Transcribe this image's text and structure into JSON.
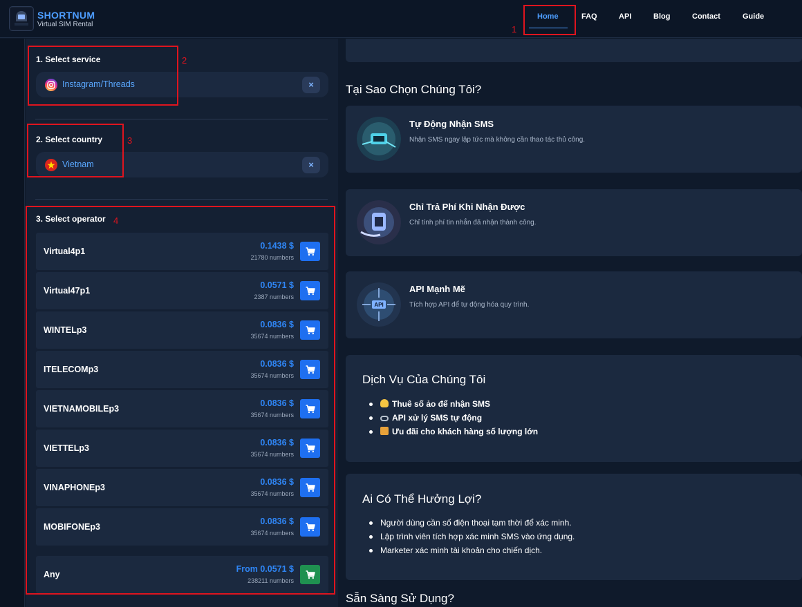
{
  "brand": {
    "name": "SHORTNUM",
    "subtitle": "Virtual SIM Rental",
    "logo_text": "SHORTNUM"
  },
  "nav": [
    {
      "label": "Home",
      "active": true
    },
    {
      "label": "FAQ"
    },
    {
      "label": "API"
    },
    {
      "label": "Blog"
    },
    {
      "label": "Contact"
    },
    {
      "label": "Guide"
    }
  ],
  "annotations": [
    "1",
    "2",
    "3",
    "4"
  ],
  "service": {
    "title": "1. Select service",
    "value": "Instagram/Threads",
    "icon": "instagram-icon",
    "clear": "×"
  },
  "country": {
    "title": "2. Select country",
    "value": "Vietnam",
    "icon": "vietnam-flag-icon",
    "clear": "×"
  },
  "operators": {
    "title": "3. Select operator",
    "items": [
      {
        "name": "Virtual4p1",
        "price": "0.1438 $",
        "count": "21780 numbers"
      },
      {
        "name": "Virtual47p1",
        "price": "0.0571 $",
        "count": "2387 numbers"
      },
      {
        "name": "WINTELp3",
        "price": "0.0836 $",
        "count": "35674 numbers"
      },
      {
        "name": "ITELECOMp3",
        "price": "0.0836 $",
        "count": "35674 numbers"
      },
      {
        "name": "VIETNAMOBILEp3",
        "price": "0.0836 $",
        "count": "35674 numbers"
      },
      {
        "name": "VIETTELp3",
        "price": "0.0836 $",
        "count": "35674 numbers"
      },
      {
        "name": "VINAPHONEp3",
        "price": "0.0836 $",
        "count": "35674 numbers"
      },
      {
        "name": "MOBIFONEp3",
        "price": "0.0836 $",
        "count": "35674 numbers"
      }
    ],
    "any": {
      "name": "Any",
      "price": "From 0.0571 $",
      "count": "238211 numbers"
    }
  },
  "why": {
    "title": "Tại Sao Chọn Chúng Tôi?",
    "features": [
      {
        "title": "Tự Động Nhận SMS",
        "desc": "Nhận SMS ngay lập tức mà không cần thao tác thủ công.",
        "icon": "sms-chip-icon"
      },
      {
        "title": "Chỉ Trả Phí Khi Nhận Được",
        "desc": "Chỉ tính phí tin nhắn đã nhận thành công.",
        "icon": "refund-icon"
      },
      {
        "title": "API Mạnh Mẽ",
        "desc": "Tích hợp API để tự động hóa quy trình.",
        "icon": "api-icon"
      }
    ]
  },
  "services": {
    "title": "Dịch Vụ Của Chúng Tôi",
    "items": [
      {
        "text": "Thuê số ảo để nhận SMS",
        "icon": "lightbulb-icon",
        "color": "#f5c542"
      },
      {
        "text": "API xử lý SMS tự động",
        "icon": "link-icon",
        "color": "#b9c3cf"
      },
      {
        "text": "Ưu đãi cho khách hàng số lượng lớn",
        "icon": "gift-icon",
        "color": "#e8a23a"
      }
    ]
  },
  "who": {
    "title": "Ai Có Thể Hưởng Lợi?",
    "items": [
      "Người dùng cần số điện thoại tạm thời để xác minh.",
      "Lập trình viên tích hợp xác minh SMS vào ứng dụng.",
      "Marketer xác minh tài khoản cho chiến dịch."
    ]
  },
  "ready": {
    "title": "Sẵn Sàng Sử Dụng?"
  }
}
